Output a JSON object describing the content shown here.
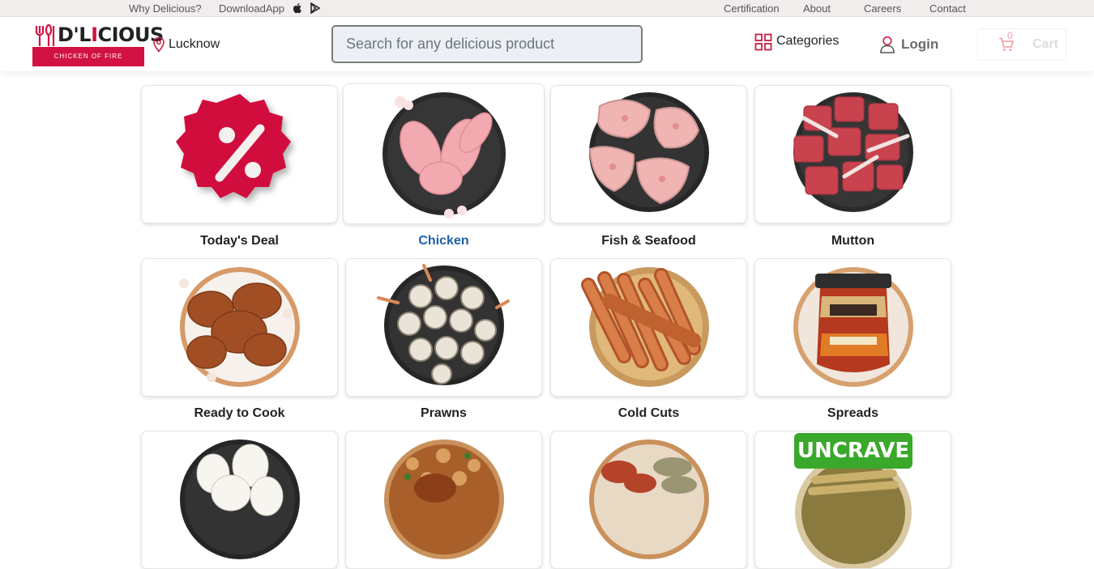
{
  "topbar": {
    "why": "Why Delicious?",
    "download": "DownloadApp",
    "certification": "Certification",
    "about": "About",
    "careers": "Careers",
    "contact": "Contact"
  },
  "header": {
    "logo_word_a": "D'L",
    "logo_word_b": "I",
    "logo_word_c": "C",
    "logo_word_d": "IOUS",
    "logo_tagline": "CHICKEN OF FIRE",
    "location": "Lucknow",
    "search_placeholder": "Search for any delicious product",
    "categories": "Categories",
    "login": "Login",
    "cart": "Cart",
    "cart_count": "0"
  },
  "categories": [
    {
      "label": "Today's Deal",
      "icon": "deal-badge",
      "active": false
    },
    {
      "label": "Chicken",
      "icon": "raw-chicken-plate",
      "active": true
    },
    {
      "label": "Fish & Seafood",
      "icon": "fish-steak-plate",
      "active": false
    },
    {
      "label": "Mutton",
      "icon": "mutton-plate",
      "active": false
    },
    {
      "label": "Ready to Cook",
      "icon": "marinated-chicken-plate",
      "active": false
    },
    {
      "label": "Prawns",
      "icon": "prawns-plate",
      "active": false
    },
    {
      "label": "Cold Cuts",
      "icon": "sausages-plate",
      "active": false
    },
    {
      "label": "Spreads",
      "icon": "spread-jar",
      "active": false
    },
    {
      "label": "",
      "icon": "eggs-plate",
      "active": false
    },
    {
      "label": "",
      "icon": "biryani-plate",
      "active": false
    },
    {
      "label": "",
      "icon": "kebab-plate",
      "active": false
    },
    {
      "label": "",
      "icon": "uncrave-product",
      "active": false
    }
  ],
  "uncrave_text": "UNCRAVE",
  "colors": {
    "brand": "#d11243",
    "active_link": "#1d5fa8",
    "uncrave_green": "#3aa82b"
  }
}
